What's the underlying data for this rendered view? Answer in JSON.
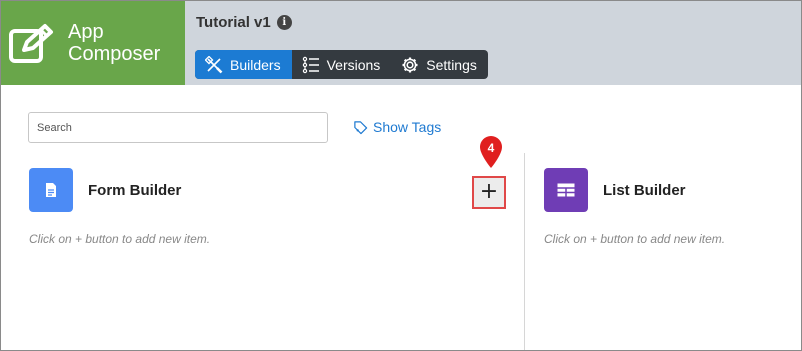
{
  "brand": {
    "line1": "App",
    "line2": "Composer",
    "icon": "edit-square-icon",
    "color": "#69a64a"
  },
  "app": {
    "title": "Tutorial v1",
    "info_icon": "info-icon"
  },
  "tabs": [
    {
      "label": "Builders",
      "icon": "builders-icon",
      "active": true
    },
    {
      "label": "Versions",
      "icon": "versions-list-icon",
      "active": false
    },
    {
      "label": "Settings",
      "icon": "gear-icon",
      "active": false
    }
  ],
  "search": {
    "placeholder": "Search",
    "value": ""
  },
  "show_tags": {
    "label": "Show Tags",
    "icon": "tag-icon"
  },
  "builders": {
    "form": {
      "title": "Form Builder",
      "hint": "Click on + button to add new item.",
      "icon": "document-icon",
      "color": "#4c8bf5",
      "add_label": "+"
    },
    "list": {
      "title": "List Builder",
      "hint": "Click on + button to add new item.",
      "icon": "grid-icon",
      "color": "#6f3db5"
    }
  },
  "step_marker": {
    "number": "4",
    "color": "#e01f1f"
  },
  "colors": {
    "accent": "#1c7bd3",
    "header_bg": "#cfd5dc",
    "tabbar_bg": "#343a40"
  }
}
